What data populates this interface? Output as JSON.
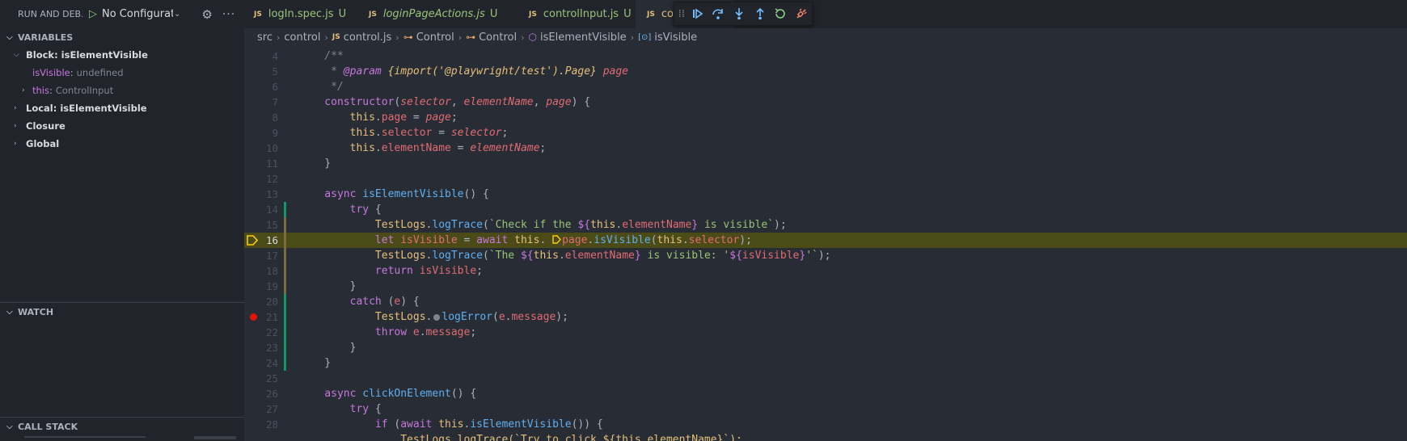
{
  "debug_sidebar": {
    "title": "RUN AND DEB...",
    "config_name": "No Configurat",
    "sections": {
      "variables": "VARIABLES",
      "watch": "WATCH",
      "call_stack": "CALL STACK"
    },
    "variables": {
      "block_scope": "Block: isElementVisible",
      "block_vars": [
        {
          "name": "isVisible",
          "sep": ":",
          "value": "undefined"
        },
        {
          "name": "this",
          "sep": ":",
          "value": "ControlInput"
        }
      ],
      "local_scope": "Local: isElementVisible",
      "closure_scope": "Closure",
      "global_scope": "Global"
    }
  },
  "tabs": [
    {
      "icon": "JS",
      "name": "logIn.spec.js",
      "status": "U"
    },
    {
      "icon": "JS",
      "name": "loginPageActions.js",
      "status": "U"
    },
    {
      "icon": "JS",
      "name": "controlInput.js",
      "status": "U"
    },
    {
      "icon": "JS",
      "name": "co"
    }
  ],
  "breadcrumbs": [
    "src",
    "control",
    "control.js",
    "Control",
    "Control",
    "isElementVisible",
    "isVisible"
  ],
  "breadcrumb_icons": {
    "js": "JS"
  },
  "editor": {
    "current_line": 16,
    "breakpoint_line": 21,
    "lines": {
      "l4": "    /**",
      "l5a": "     * ",
      "l5b": "@param",
      "l5c": " {import('@playwright/test').Page}",
      "l5d": " page",
      "l6": "     */",
      "l7a": "    constructor",
      "l7b": "(",
      "l7c": "selector",
      "l7d": ", ",
      "l7e": "elementName",
      "l7f": ", ",
      "l7g": "page",
      "l7h": ") {",
      "l8a": "        this",
      "l8b": ".",
      "l8c": "page",
      "l8d": " = ",
      "l8e": "page",
      "l8f": ";",
      "l9a": "        this",
      "l9b": ".",
      "l9c": "selector",
      "l9d": " = ",
      "l9e": "selector",
      "l9f": ";",
      "l10a": "        this",
      "l10b": ".",
      "l10c": "elementName",
      "l10d": " = ",
      "l10e": "elementName",
      "l10f": ";",
      "l11": "    }",
      "l12": "",
      "l13a": "    async",
      "l13b": " isElementVisible",
      "l13c": "() {",
      "l14a": "        try",
      "l14b": " {",
      "l15a": "            TestLogs",
      "l15b": ".",
      "l15c": "logTrace",
      "l15d": "(",
      "l15e": "`Check if the ",
      "l15f": "${",
      "l15g": "this",
      "l15h": ".",
      "l15i": "elementName",
      "l15j": "}",
      "l15k": " is visible`",
      "l15l": ");",
      "l16a": "            let",
      "l16b": " isVisible",
      "l16c": " = ",
      "l16d": "await",
      "l16e": " this",
      "l16f": ".",
      "l16g": "page",
      "l16h": ".",
      "l16i": "isVisible",
      "l16j": "(",
      "l16k": "this",
      "l16l": ".",
      "l16m": "selector",
      "l16n": ");",
      "l17a": "            TestLogs",
      "l17b": ".",
      "l17c": "logTrace",
      "l17d": "(",
      "l17e": "`The ",
      "l17f": "${",
      "l17g": "this",
      "l17h": ".",
      "l17i": "elementName",
      "l17j": "}",
      "l17k": " is visible: '",
      "l17l": "${",
      "l17m": "isVisible",
      "l17n": "}",
      "l17o": "'`",
      "l17p": ");",
      "l18a": "            return",
      "l18b": " isVisible",
      "l18c": ";",
      "l19": "        }",
      "l20a": "        catch",
      "l20b": " (",
      "l20c": "e",
      "l20d": ") {",
      "l21a": "            TestLogs",
      "l21b": ".",
      "l21c": "logError",
      "l21d": "(",
      "l21e": "e",
      "l21f": ".",
      "l21g": "message",
      "l21h": ");",
      "l22a": "            throw",
      "l22b": " e",
      "l22c": ".",
      "l22d": "message",
      "l22e": ";",
      "l23": "        }",
      "l24": "    }",
      "l25": "",
      "l26a": "    async",
      "l26b": " clickOnElement",
      "l26c": "() {",
      "l27a": "        try",
      "l27b": " {",
      "l28a": "            if",
      "l28b": " (",
      "l28c": "await",
      "l28d": " this",
      "l28e": ".",
      "l28f": "isElementVisible",
      "l28g": "()) {"
    }
  },
  "colors": {
    "background": "#282c34",
    "sidebar": "#21252b",
    "current_line": "#4b4b18",
    "breakpoint": "#e51400",
    "tab_untracked": "#98c379"
  },
  "icons": [
    "play-icon",
    "chevron-down-icon",
    "gear-icon",
    "ellipsis-icon",
    "grip-icon",
    "continue-icon",
    "step-over-icon",
    "step-into-icon",
    "step-out-icon",
    "restart-icon",
    "disconnect-icon"
  ]
}
